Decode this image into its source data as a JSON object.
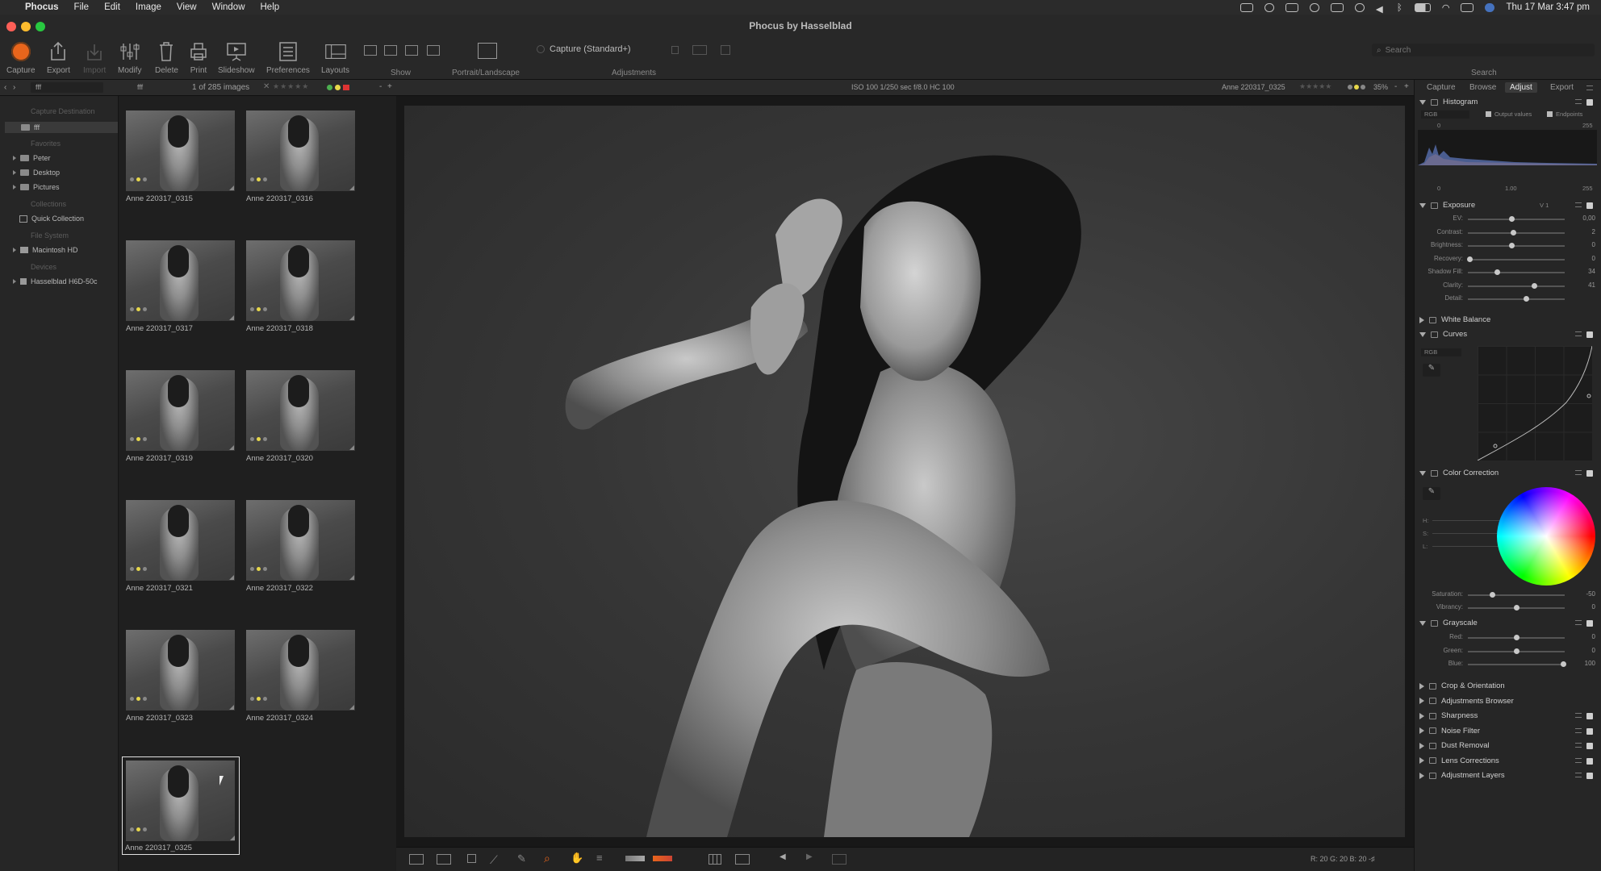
{
  "menubar": {
    "app": "Phocus",
    "items": [
      "File",
      "Edit",
      "Image",
      "View",
      "Window",
      "Help"
    ],
    "clock": "Thu 17 Mar  3:47 pm"
  },
  "window": {
    "title": "Phocus by Hasselblad"
  },
  "toolbar": {
    "buttons": [
      {
        "label": "Capture",
        "icon": "capture-icon"
      },
      {
        "label": "Export",
        "icon": "export-icon"
      },
      {
        "label": "Import",
        "icon": "import-icon"
      },
      {
        "label": "Modify",
        "icon": "modify-icon"
      },
      {
        "label": "Delete",
        "icon": "delete-icon"
      },
      {
        "label": "Print",
        "icon": "print-icon"
      },
      {
        "label": "Slideshow",
        "icon": "slideshow-icon"
      },
      {
        "label": "Preferences",
        "icon": "preferences-icon"
      },
      {
        "label": "Layouts",
        "icon": "layouts-icon"
      }
    ],
    "show_label": "Show",
    "portrait_label": "Portrait/Landscape",
    "preset": "Capture (Standard+)",
    "adjustments_label": "Adjustments",
    "search_placeholder": "Search",
    "search_label": "Search"
  },
  "infobar": {
    "folder": "fff",
    "count": "1 of 285 images",
    "exif": "ISO 100   1/250 sec   f/8.0   HC 100",
    "filename": "Anne 220317_0325",
    "zoom": "35%"
  },
  "leftpanel": {
    "capture_destination": "Capture Destination",
    "dest_folder": "fff",
    "favorites": "Favorites",
    "fav_items": [
      "Peter",
      "Desktop",
      "Pictures"
    ],
    "collections": "Collections",
    "quick_collection": "Quick Collection",
    "file_system": "File System",
    "disk": "Macintosh HD",
    "devices": "Devices",
    "camera": "Hasselblad H6D-50c"
  },
  "thumbnails": [
    "Anne 220317_0315",
    "Anne 220317_0316",
    "Anne 220317_0317",
    "Anne 220317_0318",
    "Anne 220317_0319",
    "Anne 220317_0320",
    "Anne 220317_0321",
    "Anne 220317_0322",
    "Anne 220317_0323",
    "Anne 220317_0324",
    "Anne 220317_0325"
  ],
  "selected_thumbnail": "Anne 220317_0325",
  "rightpanel": {
    "tabs": [
      "Capture",
      "Browse",
      "Adjust",
      "Export"
    ],
    "active_tab": "Adjust",
    "histogram": {
      "title": "Histogram",
      "channel": "RGB",
      "output_values": "Output values",
      "endpoints": "Endpoints",
      "top_left": "0",
      "top_right": "255",
      "bottom_left": "0",
      "bottom_mid": "1.00",
      "bottom_right": "255"
    },
    "exposure": {
      "title": "Exposure",
      "version": "V 1",
      "sliders": [
        {
          "label": "EV:",
          "value": "0,00",
          "pos": 0.45
        },
        {
          "label": "Contrast:",
          "value": "2",
          "pos": 0.47
        },
        {
          "label": "Brightness:",
          "value": "0",
          "pos": 0.45
        },
        {
          "label": "Recovery:",
          "value": "0",
          "pos": 0.02
        },
        {
          "label": "Shadow Fill:",
          "value": "34",
          "pos": 0.3
        },
        {
          "label": "Clarity:",
          "value": "41",
          "pos": 0.68
        },
        {
          "label": "Detail:",
          "value": "",
          "pos": 0.6
        }
      ]
    },
    "white_balance": "White Balance",
    "curves": {
      "title": "Curves",
      "channel": "RGB"
    },
    "color_correction": {
      "title": "Color Correction",
      "hsl": [
        "H:",
        "S:",
        "L:"
      ],
      "sliders": [
        {
          "label": "Saturation:",
          "value": "-50",
          "pos": 0.25
        },
        {
          "label": "Vibrancy:",
          "value": "0",
          "pos": 0.5
        }
      ]
    },
    "grayscale": {
      "title": "Grayscale",
      "sliders": [
        {
          "label": "Red:",
          "value": "0",
          "pos": 0.5
        },
        {
          "label": "Green:",
          "value": "0",
          "pos": 0.5
        },
        {
          "label": "Blue:",
          "value": "100",
          "pos": 0.98
        }
      ]
    },
    "collapsed_sections": [
      "Crop & Orientation",
      "Adjustments Browser",
      "Sharpness",
      "Noise Filter",
      "Dust Removal",
      "Lens Corrections",
      "Adjustment Layers"
    ]
  },
  "bottombar": {
    "rgb_readout": "R:  20  G:  20  B:  20 -♯",
    "zoom_readout": "20 -♯"
  },
  "colors": {
    "capture_button": "#e8651c",
    "label_green": "#4caf50",
    "label_yellow": "#e8d84a",
    "label_red": "#d33"
  }
}
